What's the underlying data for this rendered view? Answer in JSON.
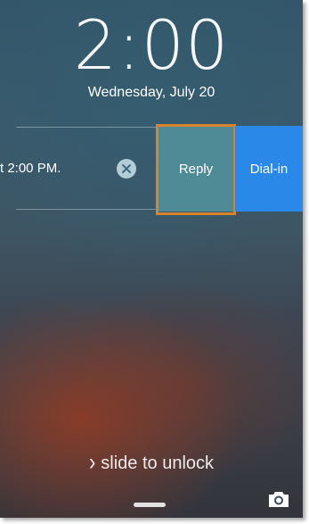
{
  "lock_screen": {
    "time": "2:00",
    "date": "Wednesday, July 20"
  },
  "notification": {
    "text": "t 2:00 PM.",
    "clear_icon": "close-icon",
    "actions": {
      "reply_label": "Reply",
      "dial_in_label": "Dial-in"
    },
    "highlight_color": "#d9832c"
  },
  "footer": {
    "slide_text": "slide to unlock",
    "slide_icon": "chevron-right-icon",
    "camera_icon": "camera-icon"
  },
  "colors": {
    "reply_bg": "#4f8b97",
    "dial_in_bg": "#2a89e8"
  }
}
